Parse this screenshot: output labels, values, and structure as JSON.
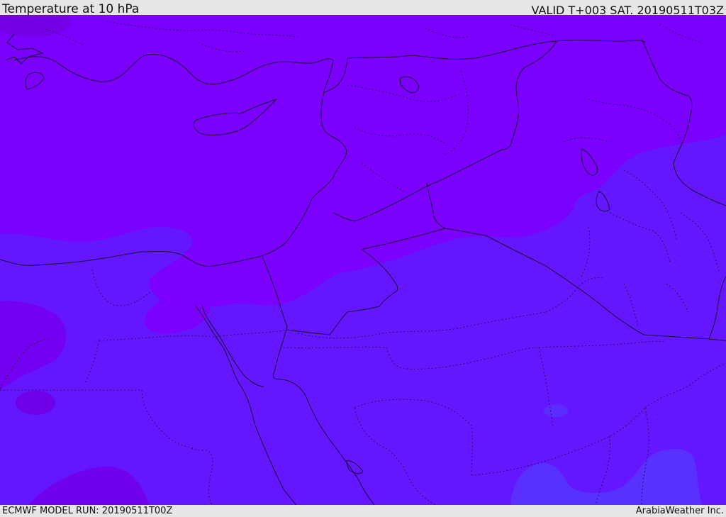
{
  "header": {
    "title": "Temperature at 10 hPa",
    "valid": "VALID T+003 SAT. 20190511T03Z"
  },
  "footer": {
    "model_run": "ECMWF MODEL RUN: 20190511T00Z",
    "credit": "ArabiaWeather Inc."
  },
  "map": {
    "colors": {
      "warm_band": "#7c00ff",
      "mid_band": "#6316ff",
      "cool_band": "#5a2dff",
      "dark_patch": "#7500e8",
      "boundary": "#1a1030"
    }
  }
}
